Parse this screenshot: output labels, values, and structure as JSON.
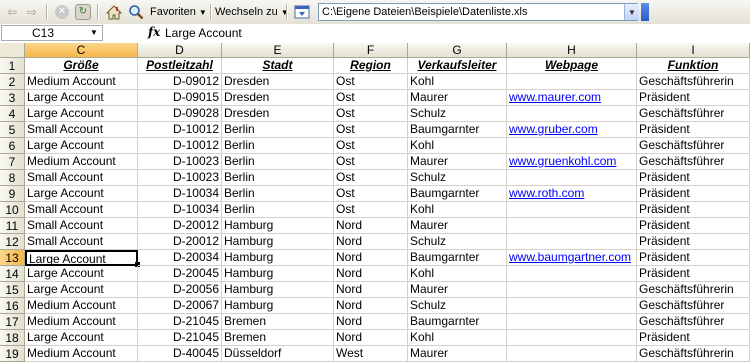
{
  "toolbar": {
    "favorites_label": "Favoriten",
    "goto_label": "Wechseln zu",
    "address": "C:\\Eigene Dateien\\Beispiele\\Datenliste.xls"
  },
  "formula_bar": {
    "cell_ref": "C13",
    "fx_label": "fx",
    "value": "Large Account"
  },
  "grid": {
    "selected_column": "C",
    "selected_row": "13",
    "column_letters": [
      "C",
      "D",
      "E",
      "F",
      "G",
      "H",
      "I"
    ],
    "rows": [
      {
        "n": "1",
        "C": "Größe",
        "D": "Postleitzahl",
        "E": "Stadt",
        "F": "Region",
        "G": "Verkaufsleiter",
        "H": "Webpage",
        "I": "Funktion"
      },
      {
        "n": "2",
        "C": "Medium Account",
        "D": "D-09012",
        "E": "Dresden",
        "F": "Ost",
        "G": "Kohl",
        "H": "",
        "I": "Geschäftsführerin"
      },
      {
        "n": "3",
        "C": "Large Account",
        "D": "D-09015",
        "E": "Dresden",
        "F": "Ost",
        "G": "Maurer",
        "H": "www.maurer.com",
        "I": "Präsident"
      },
      {
        "n": "4",
        "C": "Large Account",
        "D": "D-09028",
        "E": "Dresden",
        "F": "Ost",
        "G": "Schulz",
        "H": "",
        "I": "Geschäftsführer"
      },
      {
        "n": "5",
        "C": "Small Account",
        "D": "D-10012",
        "E": "Berlin",
        "F": "Ost",
        "G": "Baumgarnter",
        "H": "www.gruber.com",
        "I": "Präsident"
      },
      {
        "n": "6",
        "C": "Large Account",
        "D": "D-10012",
        "E": "Berlin",
        "F": "Ost",
        "G": "Kohl",
        "H": "",
        "I": "Geschäftsführer"
      },
      {
        "n": "7",
        "C": "Medium Account",
        "D": "D-10023",
        "E": "Berlin",
        "F": "Ost",
        "G": "Maurer",
        "H": "www.gruenkohl.com",
        "I": "Geschäftsführer"
      },
      {
        "n": "8",
        "C": "Small Account",
        "D": "D-10023",
        "E": "Berlin",
        "F": "Ost",
        "G": "Schulz",
        "H": "",
        "I": "Präsident"
      },
      {
        "n": "9",
        "C": "Large Account",
        "D": "D-10034",
        "E": "Berlin",
        "F": "Ost",
        "G": "Baumgarnter",
        "H": "www.roth.com",
        "I": "Präsident"
      },
      {
        "n": "10",
        "C": "Small Account",
        "D": "D-10034",
        "E": "Berlin",
        "F": "Ost",
        "G": "Kohl",
        "H": "",
        "I": "Präsident"
      },
      {
        "n": "11",
        "C": "Small Account",
        "D": "D-20012",
        "E": "Hamburg",
        "F": "Nord",
        "G": "Maurer",
        "H": "",
        "I": "Präsident"
      },
      {
        "n": "12",
        "C": "Small Account",
        "D": "D-20012",
        "E": "Hamburg",
        "F": "Nord",
        "G": "Schulz",
        "H": "",
        "I": "Präsident"
      },
      {
        "n": "13",
        "C": "Large Account",
        "D": "D-20034",
        "E": "Hamburg",
        "F": "Nord",
        "G": "Baumgarnter",
        "H": "www.baumgartner.com",
        "I": "Präsident"
      },
      {
        "n": "14",
        "C": "Large Account",
        "D": "D-20045",
        "E": "Hamburg",
        "F": "Nord",
        "G": "Kohl",
        "H": "",
        "I": "Präsident"
      },
      {
        "n": "15",
        "C": "Large Account",
        "D": "D-20056",
        "E": "Hamburg",
        "F": "Nord",
        "G": "Maurer",
        "H": "",
        "I": "Geschäftsführerin"
      },
      {
        "n": "16",
        "C": "Medium Account",
        "D": "D-20067",
        "E": "Hamburg",
        "F": "Nord",
        "G": "Schulz",
        "H": "",
        "I": "Geschäftsführer"
      },
      {
        "n": "17",
        "C": "Medium Account",
        "D": "D-21045",
        "E": "Bremen",
        "F": "Nord",
        "G": "Baumgarnter",
        "H": "",
        "I": "Geschäftsführer"
      },
      {
        "n": "18",
        "C": "Large Account",
        "D": "D-21045",
        "E": "Bremen",
        "F": "Nord",
        "G": "Kohl",
        "H": "",
        "I": "Präsident"
      },
      {
        "n": "19",
        "C": "Medium Account",
        "D": "D-40045",
        "E": "Düsseldorf",
        "F": "West",
        "G": "Maurer",
        "H": "",
        "I": "Geschäftsführerin"
      }
    ]
  },
  "icons": [
    "back-arrow-icon",
    "forward-arrow-icon",
    "stop-icon",
    "refresh-icon",
    "home-icon",
    "search-icon",
    "dropdown-arrow-icon",
    "goto-icon"
  ],
  "colors": {
    "selected_header": "#f7b64a",
    "link": "#0000ff",
    "grid_line": "#d4d0c8"
  }
}
